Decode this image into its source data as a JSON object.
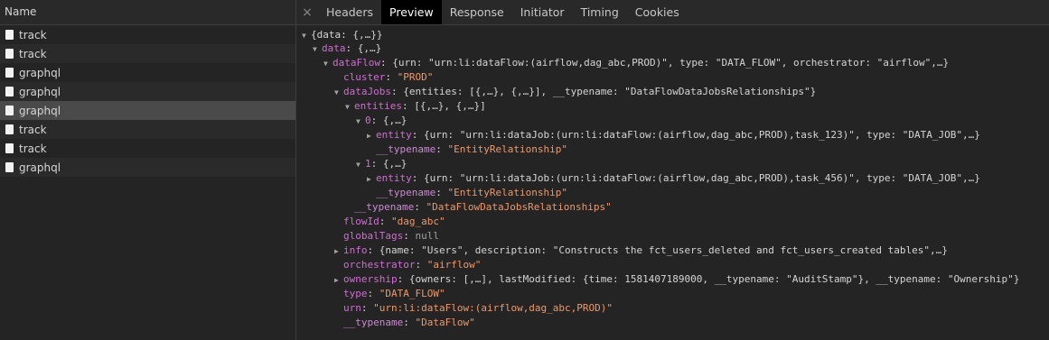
{
  "request_list": {
    "header": "Name",
    "items": [
      {
        "name": "track"
      },
      {
        "name": "track"
      },
      {
        "name": "graphql"
      },
      {
        "name": "graphql"
      },
      {
        "name": "graphql",
        "selected": true
      },
      {
        "name": "track"
      },
      {
        "name": "track"
      },
      {
        "name": "graphql"
      }
    ]
  },
  "tabs": {
    "close_glyph": "×",
    "items": [
      "Headers",
      "Preview",
      "Response",
      "Initiator",
      "Timing",
      "Cookies"
    ],
    "active": "Preview"
  },
  "preview": {
    "lines": [
      {
        "tri": "▼",
        "parts": [
          [
            "p",
            "{data: {,…}}"
          ]
        ]
      },
      {
        "tri": "▼",
        "parts": [
          [
            "k",
            "data"
          ],
          [
            "p",
            ": {,…}"
          ]
        ]
      },
      {
        "tri": "▼",
        "parts": [
          [
            "k",
            "dataFlow"
          ],
          [
            "p",
            ": {urn: \"urn:li:dataFlow:(airflow,dag_abc,PROD)\", type: \"DATA_FLOW\", orchestrator: \"airflow\",…}"
          ]
        ]
      },
      {
        "tri": "",
        "parts": [
          [
            "k",
            "cluster"
          ],
          [
            "p",
            ": "
          ],
          [
            "s",
            "\"PROD\""
          ]
        ]
      },
      {
        "tri": "▼",
        "parts": [
          [
            "k",
            "dataJobs"
          ],
          [
            "p",
            ": {entities: [{,…}, {,…}], __typename: \"DataFlowDataJobsRelationships\"}"
          ]
        ]
      },
      {
        "tri": "▼",
        "parts": [
          [
            "k",
            "entities"
          ],
          [
            "p",
            ": [{,…}, {,…}]"
          ]
        ]
      },
      {
        "tri": "▼",
        "parts": [
          [
            "k",
            "0"
          ],
          [
            "p",
            ": {,…}"
          ]
        ]
      },
      {
        "tri": "▶",
        "parts": [
          [
            "k",
            "entity"
          ],
          [
            "p",
            ": {urn: \"urn:li:dataJob:(urn:li:dataFlow:(airflow,dag_abc,PROD),task_123)\", type: \"DATA_JOB\",…}"
          ]
        ]
      },
      {
        "tri": "",
        "parts": [
          [
            "ku",
            "__typename"
          ],
          [
            "p",
            ": "
          ],
          [
            "s",
            "\"EntityRelationship\""
          ]
        ]
      },
      {
        "tri": "▼",
        "parts": [
          [
            "k",
            "1"
          ],
          [
            "p",
            ": {,…}"
          ]
        ]
      },
      {
        "tri": "▶",
        "parts": [
          [
            "k",
            "entity"
          ],
          [
            "p",
            ": {urn: \"urn:li:dataJob:(urn:li:dataFlow:(airflow,dag_abc,PROD),task_456)\", type: \"DATA_JOB\",…}"
          ]
        ]
      },
      {
        "tri": "",
        "parts": [
          [
            "ku",
            "__typename"
          ],
          [
            "p",
            ": "
          ],
          [
            "s",
            "\"EntityRelationship\""
          ]
        ]
      },
      {
        "tri": "",
        "parts": [
          [
            "ku",
            "__typename"
          ],
          [
            "p",
            ": "
          ],
          [
            "s",
            "\"DataFlowDataJobsRelationships\""
          ]
        ]
      },
      {
        "tri": "",
        "parts": [
          [
            "k",
            "flowId"
          ],
          [
            "p",
            ": "
          ],
          [
            "s",
            "\"dag_abc\""
          ]
        ]
      },
      {
        "tri": "",
        "parts": [
          [
            "k",
            "globalTags"
          ],
          [
            "p",
            ": "
          ],
          [
            "n",
            "null"
          ]
        ]
      },
      {
        "tri": "▶",
        "parts": [
          [
            "k",
            "info"
          ],
          [
            "p",
            ": {name: \"Users\", description: \"Constructs the fct_users_deleted and fct_users_created tables\",…}"
          ]
        ]
      },
      {
        "tri": "",
        "parts": [
          [
            "k",
            "orchestrator"
          ],
          [
            "p",
            ": "
          ],
          [
            "s",
            "\"airflow\""
          ]
        ]
      },
      {
        "tri": "▶",
        "parts": [
          [
            "k",
            "ownership"
          ],
          [
            "p",
            ": {owners: [,…], lastModified: {time: 1581407189000, __typename: \"AuditStamp\"}, __typename: \"Ownership\"}"
          ]
        ]
      },
      {
        "tri": "",
        "parts": [
          [
            "k",
            "type"
          ],
          [
            "p",
            ": "
          ],
          [
            "s",
            "\"DATA_FLOW\""
          ]
        ]
      },
      {
        "tri": "",
        "parts": [
          [
            "k",
            "urn"
          ],
          [
            "p",
            ": "
          ],
          [
            "s",
            "\"urn:li:dataFlow:(airflow,dag_abc,PROD)\""
          ]
        ]
      },
      {
        "tri": "",
        "parts": [
          [
            "ku",
            "__typename"
          ],
          [
            "p",
            ": "
          ],
          [
            "s",
            "\"DataFlow\""
          ]
        ]
      }
    ]
  }
}
